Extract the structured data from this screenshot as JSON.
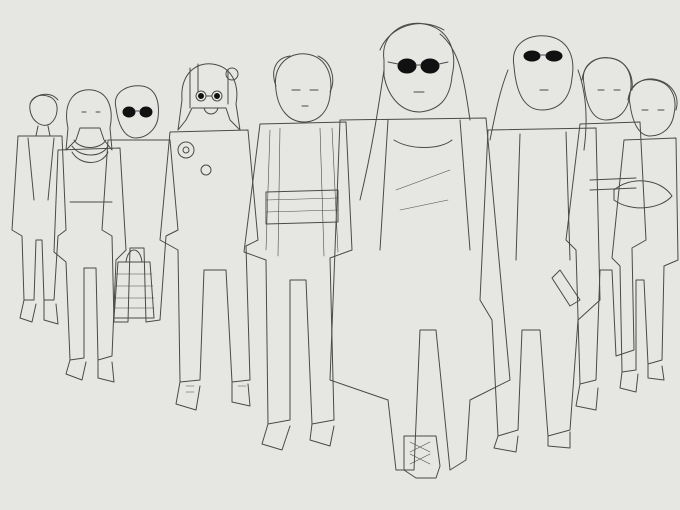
{
  "scene": {
    "background": "#e6e6e2",
    "line_color": "#4a4a4a",
    "lens_color": "#111111"
  },
  "figures": [
    {
      "id": "f1",
      "accessory": "none"
    },
    {
      "id": "f2",
      "accessory": "layered-necklace"
    },
    {
      "id": "f3",
      "accessory": "dark-sunglasses"
    },
    {
      "id": "f4",
      "accessory": "round-glasses"
    },
    {
      "id": "f5",
      "accessory": "none"
    },
    {
      "id": "f6",
      "accessory": "dark-sunglasses"
    },
    {
      "id": "f7",
      "accessory": "sunglasses-on-head"
    },
    {
      "id": "f8",
      "accessory": "none"
    },
    {
      "id": "f9",
      "accessory": "none"
    }
  ]
}
